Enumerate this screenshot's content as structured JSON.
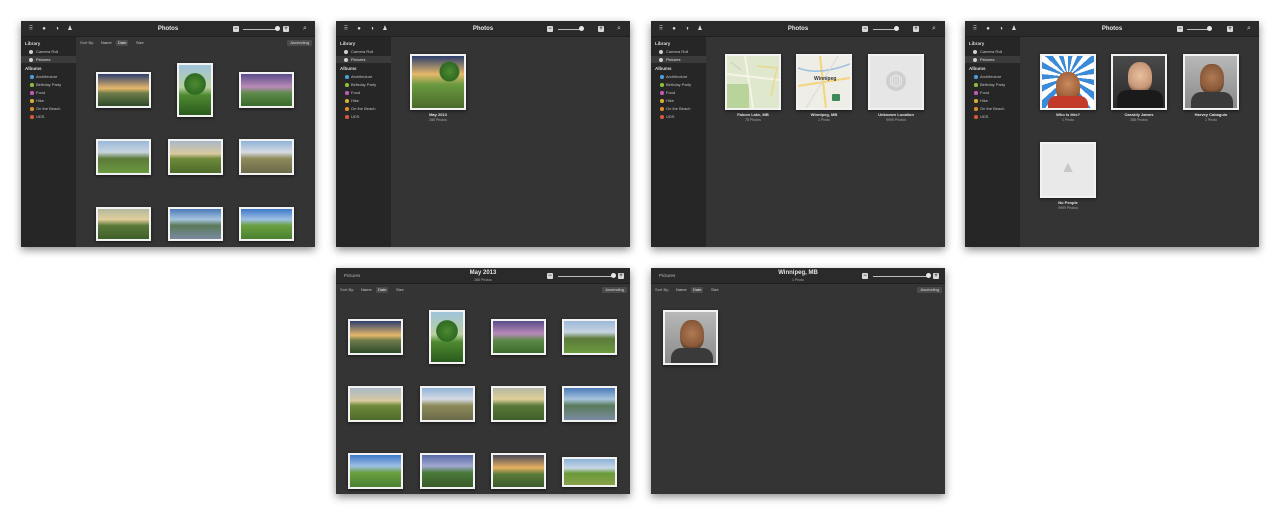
{
  "sidebar": {
    "library_label": "Library",
    "library_items": [
      "Camera Roll",
      "Pictures"
    ],
    "albums_label": "Albums",
    "albums": [
      {
        "label": "Architecture",
        "color": "#4a9fd8"
      },
      {
        "label": "Birthday Party",
        "color": "#8bbf3a"
      },
      {
        "label": "Food",
        "color": "#c05bb8"
      },
      {
        "label": "Hike",
        "color": "#d4b030"
      },
      {
        "label": "On the Beach",
        "color": "#e08a2e"
      },
      {
        "label": "UDS",
        "color": "#d9573a"
      }
    ]
  },
  "sort": {
    "label": "Sort By:",
    "options": [
      "Name",
      "Date",
      "Size"
    ],
    "selected": "Date",
    "order": "Ascending"
  },
  "windows": {
    "w1": {
      "title": "Photos"
    },
    "w2": {
      "title": "Photos",
      "event": {
        "title": "May 2013",
        "count": "288 Photos"
      }
    },
    "w3": {
      "title": "Photos",
      "places": [
        {
          "title": "Falcon Lake, MB",
          "count": "78 Photos"
        },
        {
          "title": "Winnipeg, MB",
          "count": "1 Photo",
          "map_label": "Winnipeg"
        },
        {
          "title": "Unknown Location",
          "count": "9999 Photos"
        }
      ]
    },
    "w4": {
      "title": "Photos",
      "people": [
        {
          "title": "Who is this?",
          "count": "1 Photo"
        },
        {
          "title": "Cassidy James",
          "count": "288 Photos"
        },
        {
          "title": "Harvey Cabaguio",
          "count": "1 Photo"
        },
        {
          "title": "No People",
          "count": "9999 Photos"
        }
      ]
    },
    "w5": {
      "back": "Pictures",
      "title": "May 2013",
      "subtitle": "288 Photos"
    },
    "w6": {
      "back": "Pictures",
      "title": "Winnipeg, MB",
      "subtitle": "1 Photo"
    }
  }
}
